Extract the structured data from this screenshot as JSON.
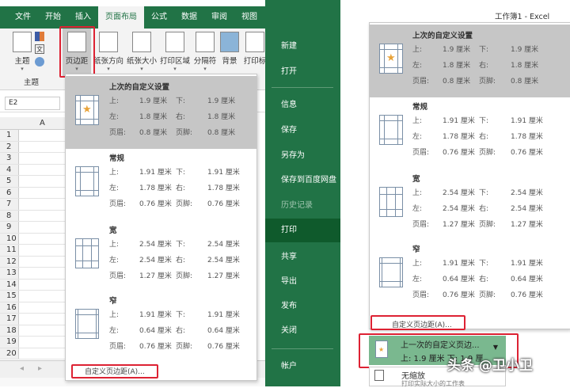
{
  "left": {
    "tabs": [
      "文件",
      "开始",
      "插入",
      "页面布局",
      "公式",
      "数据",
      "审阅",
      "视图"
    ],
    "active_tab": "页面布局",
    "ribbon": {
      "theme": "主题",
      "margins": "页边距",
      "orientation": "纸张方向",
      "size": "纸张大小",
      "print_area": "打印区域",
      "breaks": "分隔符",
      "background": "背景",
      "print_titles": "打印标",
      "group_theme": "主题"
    },
    "name_box": "E2",
    "column_a": "A",
    "rows": [
      "1",
      "2",
      "3",
      "4",
      "5",
      "6",
      "7",
      "8",
      "9",
      "10",
      "11",
      "12",
      "13",
      "14",
      "15",
      "16",
      "17",
      "18",
      "19",
      "20"
    ],
    "custom_margins": "自定义页边距(A)..."
  },
  "margins": [
    {
      "title": "上次的自定义设置",
      "top": "1.9 厘米",
      "bottom": "1.9 厘米",
      "left": "1.8 厘米",
      "right": "1.8 厘米",
      "header": "0.8 厘米",
      "footer": "0.8 厘米",
      "icon": "custom-margins-icon"
    },
    {
      "title": "常规",
      "top": "1.91 厘米",
      "bottom": "1.91 厘米",
      "left": "1.78 厘米",
      "right": "1.78 厘米",
      "header": "0.76 厘米",
      "footer": "0.76 厘米",
      "icon": "normal-margins-icon"
    },
    {
      "title": "宽",
      "top": "2.54 厘米",
      "bottom": "2.54 厘米",
      "left": "2.54 厘米",
      "right": "2.54 厘米",
      "header": "1.27 厘米",
      "footer": "1.27 厘米",
      "icon": "wide-margins-icon"
    },
    {
      "title": "窄",
      "top": "1.91 厘米",
      "bottom": "1.91 厘米",
      "left": "0.64 厘米",
      "right": "0.64 厘米",
      "header": "0.76 厘米",
      "footer": "0.76 厘米",
      "icon": "narrow-margins-icon"
    }
  ],
  "labels": {
    "top": "上:",
    "bottom": "下:",
    "left": "左:",
    "right": "右:",
    "header": "页眉:",
    "footer": "页脚:"
  },
  "right": {
    "window_title": "工作簿1 - Excel",
    "backstage": [
      "新建",
      "打开",
      "信息",
      "保存",
      "另存为",
      "保存到百度网盘",
      "历史记录",
      "打印",
      "共享",
      "导出",
      "发布",
      "关闭",
      "帐户"
    ],
    "active": "打印",
    "custom_margins": "自定义页边距(A)...",
    "margin_setting_line1": "上一次的自定义页边...",
    "margin_setting_line2": "上: 1.9 厘米 下: 1.9 厘...",
    "scaling": "无缩放",
    "scaling_sub": "打印实际大小的工作表"
  },
  "watermark": "头条 @卫小卫",
  "colors": {
    "excel_green": "#217346",
    "highlight": "#d22233"
  }
}
